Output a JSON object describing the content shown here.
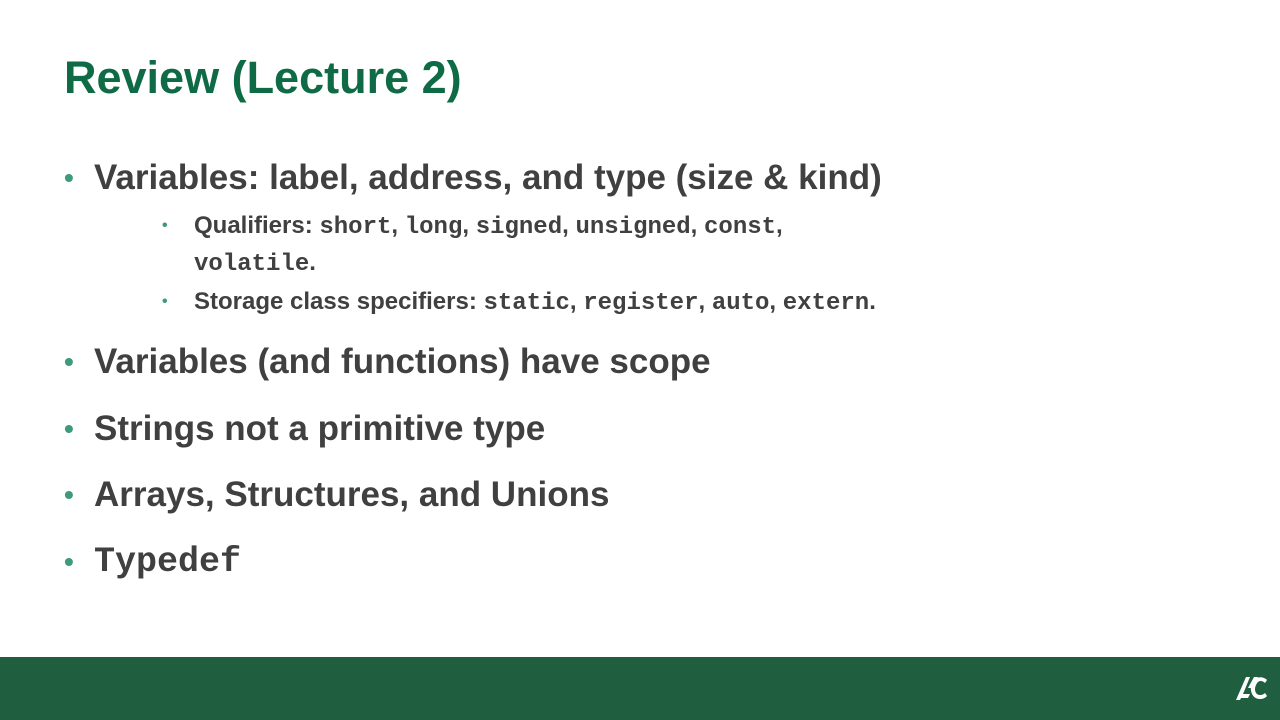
{
  "slide": {
    "title": "Review (Lecture 2)",
    "bullets": [
      {
        "text": "Variables: label, address, and type (size & kind)"
      },
      {
        "text": "Variables (and functions) have scope"
      },
      {
        "text": "Strings not a primitive type"
      },
      {
        "text": "Arrays, Structures, and Unions"
      },
      {
        "text": "Typedef"
      }
    ],
    "sub_bullets": {
      "qualifiers": {
        "label": "Qualifiers: ",
        "kw1": "short",
        "sep1": ", ",
        "kw2": "long",
        "sep2": ", ",
        "kw3": "signed",
        "sep3": ", ",
        "kw4": "unsigned",
        "sep4": ", ",
        "kw5": "const",
        "sep5": ",",
        "kw6": "volatile",
        "end": "."
      },
      "storage": {
        "label": "Storage class specifiers: ",
        "kw1": "static",
        "sep1": ", ",
        "kw2": "register",
        "sep2": ", ",
        "kw3": "auto",
        "sep3": ", ",
        "kw4": "extern",
        "end": "."
      }
    }
  },
  "colors": {
    "title": "#0f6b45",
    "bullet_dot": "#3e9b78",
    "body_text": "#404040",
    "footer": "#1f5e3f"
  },
  "footer": {
    "logo_icon": "ac-logo-icon"
  }
}
